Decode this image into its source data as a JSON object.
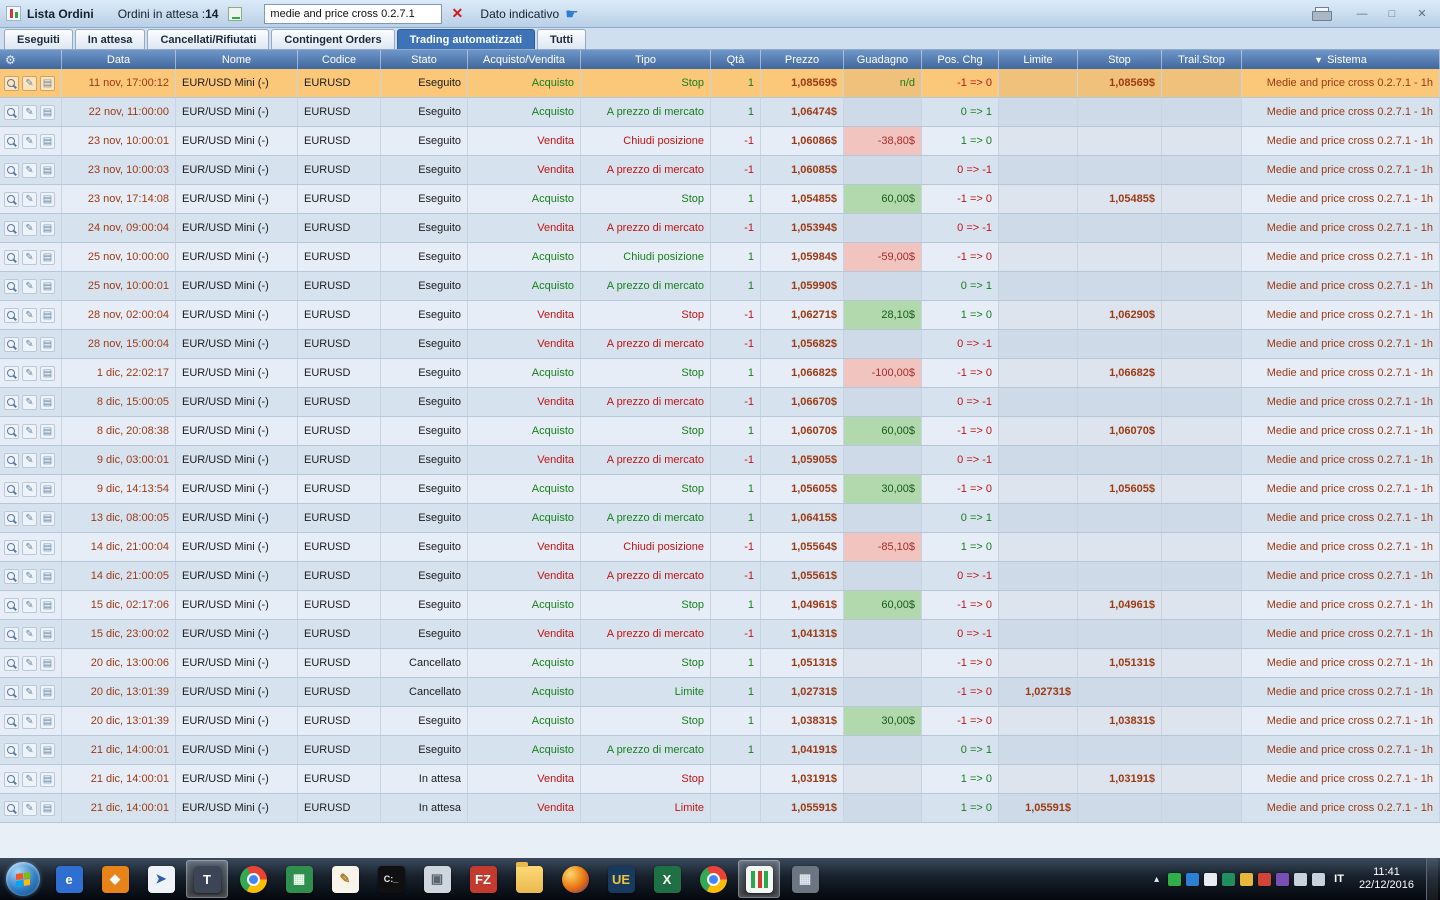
{
  "titlebar": {
    "title": "Lista Ordini",
    "pending_label": "Ordini in attesa :",
    "pending_count": "14",
    "filter_value": "medie and price cross 0.2.7.1",
    "indicative_label": "Dato indicativo"
  },
  "icons": {
    "clear": "✕",
    "hand": "☛",
    "sort": "▼",
    "wrench": "⚙",
    "edit": "✎",
    "doc": "▤",
    "minimize": "—",
    "maximize": "□",
    "close": "✕",
    "tray_chevron": "▴"
  },
  "tabs": [
    {
      "label": "Eseguiti",
      "active": false
    },
    {
      "label": "In attesa",
      "active": false
    },
    {
      "label": "Cancellati/Rifiutati",
      "active": false
    },
    {
      "label": "Contingent Orders",
      "active": false
    },
    {
      "label": "Trading automatizzati",
      "active": true
    },
    {
      "label": "Tutti",
      "active": false
    }
  ],
  "table": {
    "columns": [
      "Data",
      "Nome",
      "Codice",
      "Stato",
      "Acquisto/Vendita",
      "Tipo",
      "Qtà",
      "Prezzo",
      "Guadagno",
      "Pos. Chg",
      "Limite",
      "Stop",
      "Trail.Stop",
      "Sistema"
    ],
    "sorted_column": "Sistema",
    "common": {
      "name": "EUR/USD Mini (-)",
      "code": "EURUSD",
      "system": "Medie and price cross 0.2.7.1 - 1h"
    },
    "rows": [
      {
        "date": "11 nov, 17:00:12",
        "status": "Eseguito",
        "side": "Acquisto",
        "type": "Stop",
        "qty": "1",
        "price": "1,08569$",
        "gain": "n/d",
        "poschg": "-1 => 0",
        "stop": "1,08569$",
        "selected": true
      },
      {
        "date": "22 nov, 11:00:00",
        "status": "Eseguito",
        "side": "Acquisto",
        "type": "A prezzo di mercato",
        "qty": "1",
        "price": "1,06474$",
        "gain": "",
        "poschg": "0 => 1"
      },
      {
        "date": "23 nov, 10:00:01",
        "status": "Eseguito",
        "side": "Vendita",
        "type": "Chiudi posizione",
        "qty": "-1",
        "price": "1,06086$",
        "gain": "-38,80$",
        "poschg": "1 => 0"
      },
      {
        "date": "23 nov, 10:00:03",
        "status": "Eseguito",
        "side": "Vendita",
        "type": "A prezzo di mercato",
        "qty": "-1",
        "price": "1,06085$",
        "gain": "",
        "poschg": "0 => -1"
      },
      {
        "date": "23 nov, 17:14:08",
        "status": "Eseguito",
        "side": "Acquisto",
        "type": "Stop",
        "qty": "1",
        "price": "1,05485$",
        "gain": "60,00$",
        "poschg": "-1 => 0",
        "stop": "1,05485$"
      },
      {
        "date": "24 nov, 09:00:04",
        "status": "Eseguito",
        "side": "Vendita",
        "type": "A prezzo di mercato",
        "qty": "-1",
        "price": "1,05394$",
        "gain": "",
        "poschg": "0 => -1"
      },
      {
        "date": "25 nov, 10:00:00",
        "status": "Eseguito",
        "side": "Acquisto",
        "type": "Chiudi posizione",
        "qty": "1",
        "price": "1,05984$",
        "gain": "-59,00$",
        "poschg": "-1 => 0"
      },
      {
        "date": "25 nov, 10:00:01",
        "status": "Eseguito",
        "side": "Acquisto",
        "type": "A prezzo di mercato",
        "qty": "1",
        "price": "1,05990$",
        "gain": "",
        "poschg": "0 => 1"
      },
      {
        "date": "28 nov, 02:00:04",
        "status": "Eseguito",
        "side": "Vendita",
        "type": "Stop",
        "qty": "-1",
        "price": "1,06271$",
        "gain": "28,10$",
        "poschg": "1 => 0",
        "stop": "1,06290$"
      },
      {
        "date": "28 nov, 15:00:04",
        "status": "Eseguito",
        "side": "Vendita",
        "type": "A prezzo di mercato",
        "qty": "-1",
        "price": "1,05682$",
        "gain": "",
        "poschg": "0 => -1"
      },
      {
        "date": "1 dic, 22:02:17",
        "status": "Eseguito",
        "side": "Acquisto",
        "type": "Stop",
        "qty": "1",
        "price": "1,06682$",
        "gain": "-100,00$",
        "poschg": "-1 => 0",
        "stop": "1,06682$"
      },
      {
        "date": "8 dic, 15:00:05",
        "status": "Eseguito",
        "side": "Vendita",
        "type": "A prezzo di mercato",
        "qty": "-1",
        "price": "1,06670$",
        "gain": "",
        "poschg": "0 => -1"
      },
      {
        "date": "8 dic, 20:08:38",
        "status": "Eseguito",
        "side": "Acquisto",
        "type": "Stop",
        "qty": "1",
        "price": "1,06070$",
        "gain": "60,00$",
        "poschg": "-1 => 0",
        "stop": "1,06070$"
      },
      {
        "date": "9 dic, 03:00:01",
        "status": "Eseguito",
        "side": "Vendita",
        "type": "A prezzo di mercato",
        "qty": "-1",
        "price": "1,05905$",
        "gain": "",
        "poschg": "0 => -1"
      },
      {
        "date": "9 dic, 14:13:54",
        "status": "Eseguito",
        "side": "Acquisto",
        "type": "Stop",
        "qty": "1",
        "price": "1,05605$",
        "gain": "30,00$",
        "poschg": "-1 => 0",
        "stop": "1,05605$"
      },
      {
        "date": "13 dic, 08:00:05",
        "status": "Eseguito",
        "side": "Acquisto",
        "type": "A prezzo di mercato",
        "qty": "1",
        "price": "1,06415$",
        "gain": "",
        "poschg": "0 => 1"
      },
      {
        "date": "14 dic, 21:00:04",
        "status": "Eseguito",
        "side": "Vendita",
        "type": "Chiudi posizione",
        "qty": "-1",
        "price": "1,05564$",
        "gain": "-85,10$",
        "poschg": "1 => 0"
      },
      {
        "date": "14 dic, 21:00:05",
        "status": "Eseguito",
        "side": "Vendita",
        "type": "A prezzo di mercato",
        "qty": "-1",
        "price": "1,05561$",
        "gain": "",
        "poschg": "0 => -1"
      },
      {
        "date": "15 dic, 02:17:06",
        "status": "Eseguito",
        "side": "Acquisto",
        "type": "Stop",
        "qty": "1",
        "price": "1,04961$",
        "gain": "60,00$",
        "poschg": "-1 => 0",
        "stop": "1,04961$"
      },
      {
        "date": "15 dic, 23:00:02",
        "status": "Eseguito",
        "side": "Vendita",
        "type": "A prezzo di mercato",
        "qty": "-1",
        "price": "1,04131$",
        "gain": "",
        "poschg": "0 => -1"
      },
      {
        "date": "20 dic, 13:00:06",
        "status": "Cancellato",
        "side": "Acquisto",
        "type": "Stop",
        "qty": "1",
        "price": "1,05131$",
        "gain": "",
        "poschg": "-1 => 0",
        "stop": "1,05131$"
      },
      {
        "date": "20 dic, 13:01:39",
        "status": "Cancellato",
        "side": "Acquisto",
        "type": "Limite",
        "qty": "1",
        "price": "1,02731$",
        "gain": "",
        "poschg": "-1 => 0",
        "limit": "1,02731$"
      },
      {
        "date": "20 dic, 13:01:39",
        "status": "Eseguito",
        "side": "Acquisto",
        "type": "Stop",
        "qty": "1",
        "price": "1,03831$",
        "gain": "30,00$",
        "poschg": "-1 => 0",
        "stop": "1,03831$"
      },
      {
        "date": "21 dic, 14:00:01",
        "status": "Eseguito",
        "side": "Acquisto",
        "type": "A prezzo di mercato",
        "qty": "1",
        "price": "1,04191$",
        "gain": "",
        "poschg": "0 => 1"
      },
      {
        "date": "21 dic, 14:00:01",
        "status": "In attesa",
        "side": "Vendita",
        "type": "Stop",
        "qty": "",
        "price": "1,03191$",
        "gain": "",
        "poschg": "1 => 0",
        "stop": "1,03191$"
      },
      {
        "date": "21 dic, 14:00:01",
        "status": "In attesa",
        "side": "Vendita",
        "type": "Limite",
        "qty": "",
        "price": "1,05591$",
        "gain": "",
        "poschg": "1 => 0",
        "limit": "1,05591$"
      }
    ]
  },
  "taskbar": {
    "language": "IT",
    "clock_time": "11:41",
    "clock_date": "22/12/2016",
    "icons": [
      {
        "name": "internet-explorer",
        "glyph": "e",
        "bg": "#2f6fd2",
        "fg": "#ffffff"
      },
      {
        "name": "orange-app",
        "glyph": "◆",
        "bg": "#e8831a",
        "fg": "#ffffff"
      },
      {
        "name": "pointer-app",
        "glyph": "➤",
        "bg": "#eef3f9",
        "fg": "#2a5db0"
      },
      {
        "name": "t-trading-tool",
        "glyph": "T",
        "bg": "#3c4556",
        "fg": "#ffffff",
        "active": true
      },
      {
        "name": "chrome",
        "type": "chrome"
      },
      {
        "name": "remote-desktop",
        "glyph": "▦",
        "bg": "#2f8f4e",
        "fg": "#eafbea"
      },
      {
        "name": "text-editor",
        "glyph": "✎",
        "bg": "#f7f4ea",
        "fg": "#b07c28"
      },
      {
        "name": "command-prompt",
        "glyph": "C:_",
        "bg": "#101010",
        "fg": "#e8e8e8"
      },
      {
        "name": "security-tool",
        "glyph": "▣",
        "bg": "#cfd6de",
        "fg": "#5a6572"
      },
      {
        "name": "filezilla",
        "glyph": "FZ",
        "bg": "#c33b2e",
        "fg": "#ffffff"
      },
      {
        "name": "file-explorer",
        "type": "folder"
      },
      {
        "name": "browser-ball",
        "type": "ball"
      },
      {
        "name": "ultraedit",
        "glyph": "UE",
        "bg": "#173a5e",
        "fg": "#f0c33c"
      },
      {
        "name": "excel",
        "glyph": "X",
        "bg": "#1f7145",
        "fg": "#ffffff"
      },
      {
        "name": "chrome-2",
        "type": "chrome"
      },
      {
        "name": "trading-chart-app",
        "type": "candles",
        "active": true
      },
      {
        "name": "calculator",
        "glyph": "▦",
        "bg": "#6b7682",
        "fg": "#dfe5ec"
      }
    ],
    "tray": [
      {
        "name": "tray-green-app",
        "bg": "#2fae4a"
      },
      {
        "name": "tray-blue-app",
        "bg": "#2b7fd4"
      },
      {
        "name": "tray-white-app",
        "bg": "#e8ecf1"
      },
      {
        "name": "tray-chart-app",
        "bg": "#1f8f5f"
      },
      {
        "name": "tray-yellow-app",
        "bg": "#e7b73c"
      },
      {
        "name": "tray-red-app",
        "bg": "#d24436"
      },
      {
        "name": "tray-purple-app",
        "bg": "#7a4fb5"
      },
      {
        "name": "network-icon",
        "bg": "#c8d2dc"
      },
      {
        "name": "volume-icon",
        "bg": "#c8d2dc"
      }
    ]
  },
  "colors": {
    "header": "#4f81bd",
    "selected_row": "#fbc778",
    "buy": "#17801c",
    "sell": "#c11414",
    "price_text": "#9c3a14",
    "gain_pos_bg": "#b2d9ae",
    "gain_neg_bg": "#f2c4bf"
  }
}
